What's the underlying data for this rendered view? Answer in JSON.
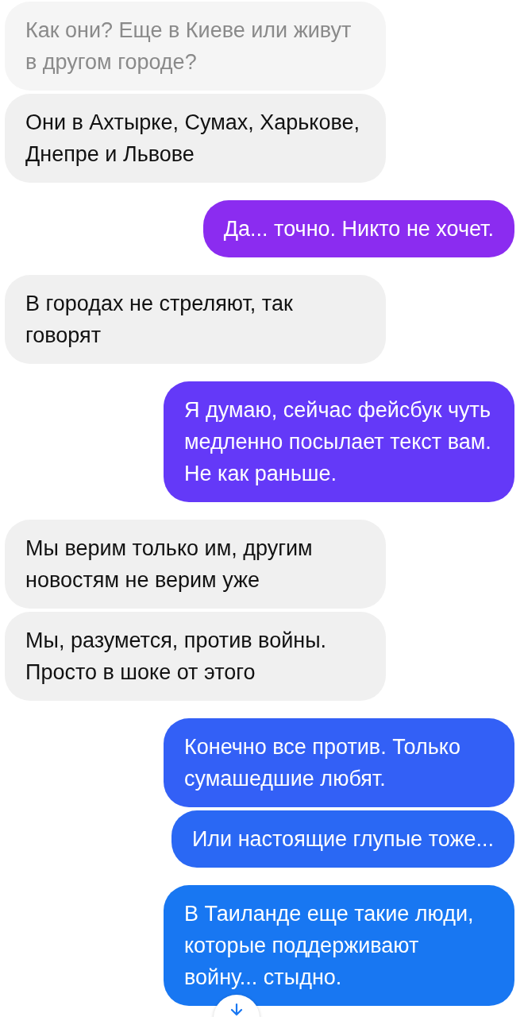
{
  "groups": [
    {
      "kind": "incoming",
      "messages": [
        {
          "faded": true,
          "text": "Как они? Еще в Киеве или живут в другом городе?"
        },
        {
          "faded": false,
          "text": "Они в Ахтырке, Сумах, Харькове, Днепре и Львове"
        }
      ]
    },
    {
      "kind": "outgoing",
      "messages": [
        {
          "color": "#8b2cf0",
          "text": "Да... точно. Никто не хочет."
        }
      ]
    },
    {
      "kind": "incoming",
      "messages": [
        {
          "faded": false,
          "text": "В городах не стреляют, так говорят"
        }
      ]
    },
    {
      "kind": "outgoing",
      "messages": [
        {
          "color": "#6439f8",
          "text": "Я думаю, сейчас фейсбук чуть медленно посылает текст вам. Не как раньше."
        }
      ]
    },
    {
      "kind": "incoming",
      "messages": [
        {
          "faded": false,
          "text": "Мы верим только им, другим новостям не верим уже"
        },
        {
          "faded": false,
          "text": "Мы, разумется, против войны. Просто в шоке от этого"
        }
      ]
    },
    {
      "kind": "outgoing",
      "messages": [
        {
          "color": "#3360f6",
          "text": "Конечно все против. Только сумашедшие любят."
        },
        {
          "color": "#2a68f4",
          "text": "Или настоящие глупые тоже..."
        }
      ]
    },
    {
      "kind": "outgoing",
      "messages": [
        {
          "color": "#1877f2",
          "text": "В Таиланде еще такие люди, которые поддерживают войну... стыдно."
        }
      ]
    }
  ],
  "scroll_down_button": {
    "visible": true
  }
}
